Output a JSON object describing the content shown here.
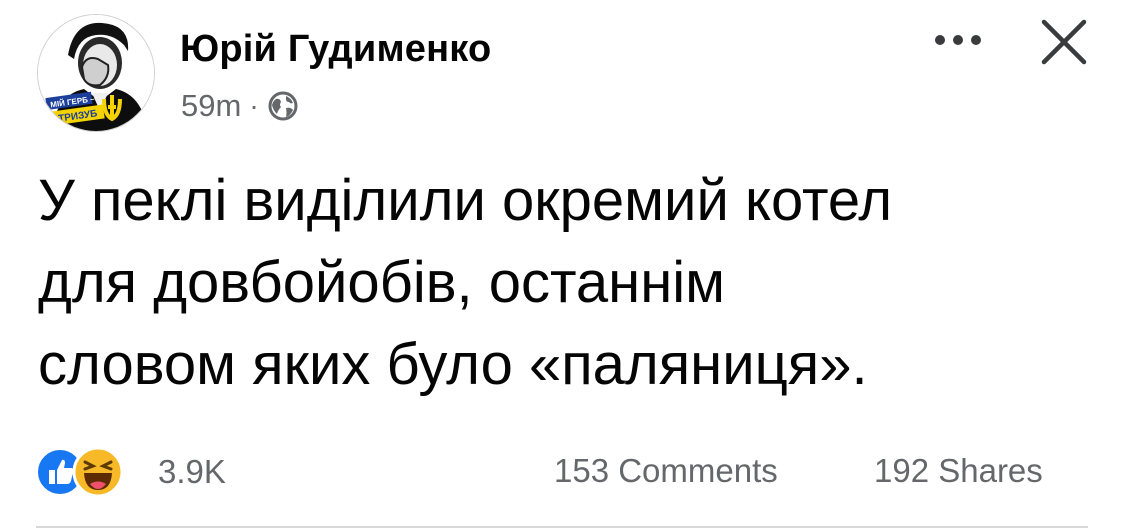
{
  "post": {
    "author": "Юрій Гудименко",
    "time": "59m",
    "separator": "·",
    "audience_icon": "globe-icon",
    "avatar": {
      "badge_line1": "МІЙ ГЕРБ –",
      "badge_line2": "ТРИЗУБ",
      "badge_color": "#1c3f9c",
      "accent_color": "#f5d300"
    },
    "text_lines": [
      "У пеклі виділили окремий котел",
      "для довбойобів, останнім",
      "словом яких було «паляниця»."
    ],
    "reactions": {
      "icons": [
        "like-icon",
        "haha-icon"
      ],
      "count": "3.9K"
    },
    "comments": "153 Comments",
    "shares": "192 Shares"
  },
  "colors": {
    "text": "#050505",
    "secondary": "#65676b",
    "like_blue": "#1877f2",
    "haha_yellow": "#f7b928"
  }
}
